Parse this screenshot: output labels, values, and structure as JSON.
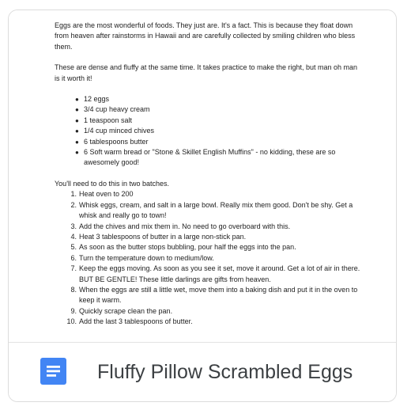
{
  "document": {
    "paragraphs": [
      "Eggs are the most wonderful of foods. They just are. It's a fact. This is because they float down from heaven after rainstorms in Hawaii and are carefully collected by smiling children who bless them.",
      "These are dense and fluffy at the same time. It takes practice to make the right, but man oh man is it worth it!"
    ],
    "ingredients": [
      "12 eggs",
      "3/4 cup heavy cream",
      "1 teaspoon salt",
      "1/4 cup minced chives",
      "6 tablespoons butter",
      "6 Soft warm bread or \"Stone & Skillet English Muffins\" - no kidding, these are so awesomely good!"
    ],
    "intro": "You'll need to do this in two batches.",
    "steps": [
      "Heat oven to 200",
      "Whisk eggs, cream, and salt in a large bowl. Really mix them good. Don't be shy. Get a whisk and really go to town!",
      "Add the chives and mix them in. No need to go overboard with this.",
      "Heat 3 tablespoons of butter in a large non-stick pan.",
      "As soon as the butter stops bubbling, pour half the eggs into the pan.",
      "Turn the temperature down to medium/low.",
      "Keep the eggs moving. As soon as you see it set, move it around. Get a lot of air in there. BUT BE GENTLE! These little darlings are gifts from heaven.",
      "When the eggs are still a little wet, move them into a baking dish and put it in the oven to keep it warm.",
      "Quickly scrape clean the pan.",
      "Add the last 3 tablespoons of butter."
    ]
  },
  "footer": {
    "icon": "google-docs-icon",
    "title": "Fluffy Pillow Scrambled Eggs"
  },
  "colors": {
    "docs_blue": "#4285f4",
    "docs_blue_dark": "#2a56c6",
    "title_text": "#3c4043"
  }
}
